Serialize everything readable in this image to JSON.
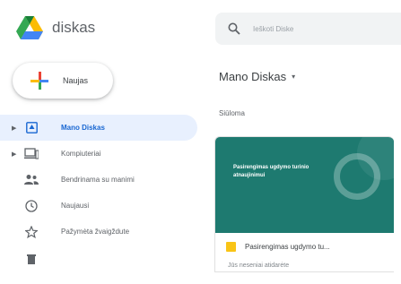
{
  "app": {
    "brand": "diskas"
  },
  "new_button": {
    "label": "Naujas"
  },
  "sidebar": {
    "items": [
      {
        "label": "Mano Diskas",
        "icon": "drive-folder-icon",
        "active": true,
        "expandable": true
      },
      {
        "label": "Kompiuteriai",
        "icon": "computer-icon",
        "active": false,
        "expandable": true
      },
      {
        "label": "Bendrinama su manimi",
        "icon": "shared-people-icon",
        "active": false,
        "expandable": false
      },
      {
        "label": "Naujausi",
        "icon": "clock-icon",
        "active": false,
        "expandable": false
      },
      {
        "label": "Pažymėta žvaigždute",
        "icon": "star-icon",
        "active": false,
        "expandable": false
      },
      {
        "label": "",
        "icon": "trash-icon",
        "active": false,
        "expandable": false
      }
    ]
  },
  "search": {
    "placeholder": "Ieškoti Diske"
  },
  "main": {
    "title": "Mano Diskas",
    "title_caret": "▾",
    "section_label": "Siūloma"
  },
  "file_card": {
    "thumbnail_title": "Pasirengimas ugdymo turinio atnaujinimui",
    "name": "Pasirengimas ugdymo tu...",
    "subtitle": "Jūs neseniai atidarėte",
    "icon": "slides-file-icon",
    "thumbnail_color": "#1e7a70"
  },
  "colors": {
    "accent": "#1967d2",
    "active_bg": "#e8f0fe"
  }
}
